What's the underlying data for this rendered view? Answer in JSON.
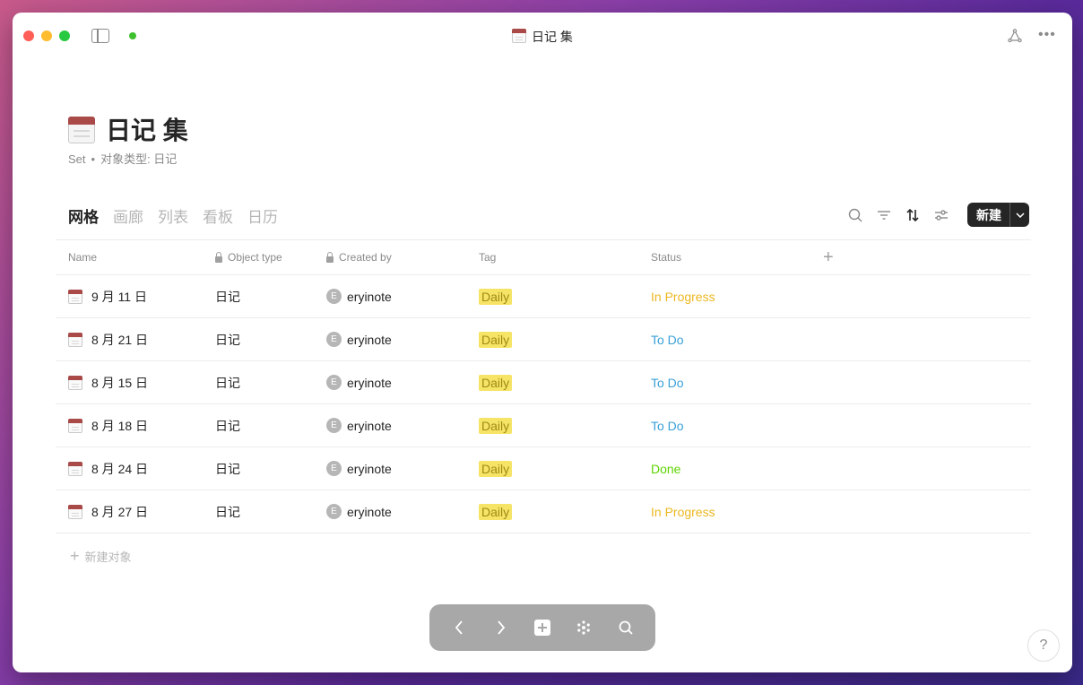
{
  "window": {
    "title": "日记 集"
  },
  "page": {
    "title": "日记 集",
    "subtitle_kind": "Set",
    "subtitle_type": "对象类型: 日记"
  },
  "views": {
    "tabs": [
      "网格",
      "画廊",
      "列表",
      "看板",
      "日历"
    ],
    "active": "网格"
  },
  "toolbar": {
    "new_label": "新建"
  },
  "table": {
    "columns": {
      "name": "Name",
      "object_type": "Object type",
      "created_by": "Created by",
      "tag": "Tag",
      "status": "Status"
    },
    "rows": [
      {
        "name": "9 月 11 日",
        "object_type": "日记",
        "avatar": "E",
        "created_by": "eryinote",
        "tag": "Daily",
        "status": "In Progress"
      },
      {
        "name": "8 月 21 日",
        "object_type": "日记",
        "avatar": "E",
        "created_by": "eryinote",
        "tag": "Daily",
        "status": "To Do"
      },
      {
        "name": "8 月 15 日",
        "object_type": "日记",
        "avatar": "E",
        "created_by": "eryinote",
        "tag": "Daily",
        "status": "To Do"
      },
      {
        "name": "8 月 18 日",
        "object_type": "日记",
        "avatar": "E",
        "created_by": "eryinote",
        "tag": "Daily",
        "status": "To Do"
      },
      {
        "name": "8 月 24 日",
        "object_type": "日记",
        "avatar": "E",
        "created_by": "eryinote",
        "tag": "Daily",
        "status": "Done"
      },
      {
        "name": "8 月 27 日",
        "object_type": "日记",
        "avatar": "E",
        "created_by": "eryinote",
        "tag": "Daily",
        "status": "In Progress"
      }
    ],
    "new_object_label": "新建对象"
  },
  "status_colors": {
    "In Progress": "#ecb720",
    "To Do": "#3aa0d8",
    "Done": "#5dd400"
  },
  "help": {
    "label": "?"
  }
}
